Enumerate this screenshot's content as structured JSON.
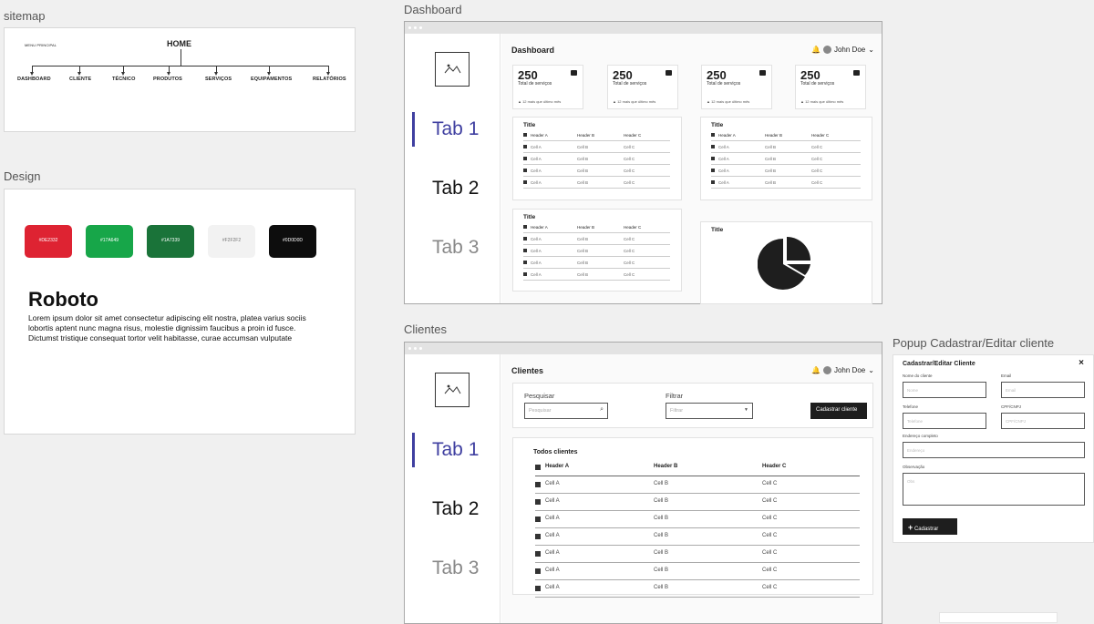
{
  "labels": {
    "sitemap": "sitemap",
    "design": "Design",
    "dashboard": "Dashboard",
    "clientes": "Clientes",
    "popup": "Popup Cadastrar/Editar cliente"
  },
  "sitemap": {
    "menu": "MENU PRINCIPAL",
    "home": "HOME",
    "nodes": [
      "DASHBOARD",
      "CLIENTE",
      "TÉCNICO",
      "PRODUTOS",
      "SERVIÇOS",
      "EQUIPAMENTOS",
      "RELATÓRIOS"
    ]
  },
  "design": {
    "swatches": [
      {
        "label": "#DE2332",
        "color": "#DE2332"
      },
      {
        "label": "#17A649",
        "color": "#17A649"
      },
      {
        "label": "#1A7339",
        "color": "#1A7339"
      },
      {
        "label": "#F2F2F2",
        "color": "#F2F2F2"
      },
      {
        "label": "#0D0D0D",
        "color": "#0D0D0D"
      }
    ],
    "font_name": "Roboto",
    "sample": "Lorem ipsum dolor sit amet consectetur adipiscing elit nostra, platea varius sociis lobortis aptent nunc magna risus, molestie dignissim faucibus a proin id fusce. Dictumst tristique consequat tortor velit habitasse, curae accumsan vulputate"
  },
  "tabs": [
    "Tab 1",
    "Tab 2",
    "Tab 3"
  ],
  "user": "John Doe",
  "dashboard": {
    "title": "Dashboard",
    "stats": [
      {
        "value": "250",
        "label": "Total de serviços",
        "foot": "▲ 12 mais que último mês"
      },
      {
        "value": "250",
        "label": "Total de serviços",
        "foot": "▲ 12 mais que último mês"
      },
      {
        "value": "250",
        "label": "Total de serviços",
        "foot": "▲ 12 mais que último mês"
      },
      {
        "value": "250",
        "label": "Total de serviços",
        "foot": "▲ 12 mais que último mês"
      }
    ],
    "table_title": "Title",
    "headers": [
      "Header A",
      "Header B",
      "Header C"
    ],
    "rows": [
      [
        "Cell A",
        "Cell B",
        "Cell C"
      ],
      [
        "Cell A",
        "Cell B",
        "Cell C"
      ],
      [
        "Cell A",
        "Cell B",
        "Cell C"
      ],
      [
        "Cell A",
        "Cell B",
        "Cell C"
      ]
    ],
    "chart_title": "Title"
  },
  "clientes": {
    "title": "Clientes",
    "search_label": "Pesquisar",
    "search_placeholder": "Pesquisar",
    "filter_label": "Filtrar",
    "filter_placeholder": "Filtrar",
    "add_button": "Cadastrar cliente",
    "table_title": "Todos clientes",
    "headers": [
      "Header A",
      "Header B",
      "Header C"
    ],
    "rows": [
      [
        "Cell A",
        "Cell B",
        "Cell C"
      ],
      [
        "Cell A",
        "Cell B",
        "Cell C"
      ],
      [
        "Cell A",
        "Cell B",
        "Cell C"
      ],
      [
        "Cell A",
        "Cell B",
        "Cell C"
      ],
      [
        "Cell A",
        "Cell B",
        "Cell C"
      ],
      [
        "Cell A",
        "Cell B",
        "Cell C"
      ],
      [
        "Cell A",
        "Cell B",
        "Cell C"
      ]
    ]
  },
  "popup": {
    "title": "Cadastrar/Editar Cliente",
    "fields": [
      {
        "label": "Nome do cliente",
        "placeholder": "Nome"
      },
      {
        "label": "Email",
        "placeholder": "Email"
      },
      {
        "label": "Telefone",
        "placeholder": "Telefone"
      },
      {
        "label": "CPF/CNPJ",
        "placeholder": "CPF/CNPJ"
      },
      {
        "label": "Endereço completo",
        "placeholder": "Endereço"
      },
      {
        "label": "Observação",
        "placeholder": "Obs"
      }
    ],
    "submit": "Cadastrar"
  }
}
